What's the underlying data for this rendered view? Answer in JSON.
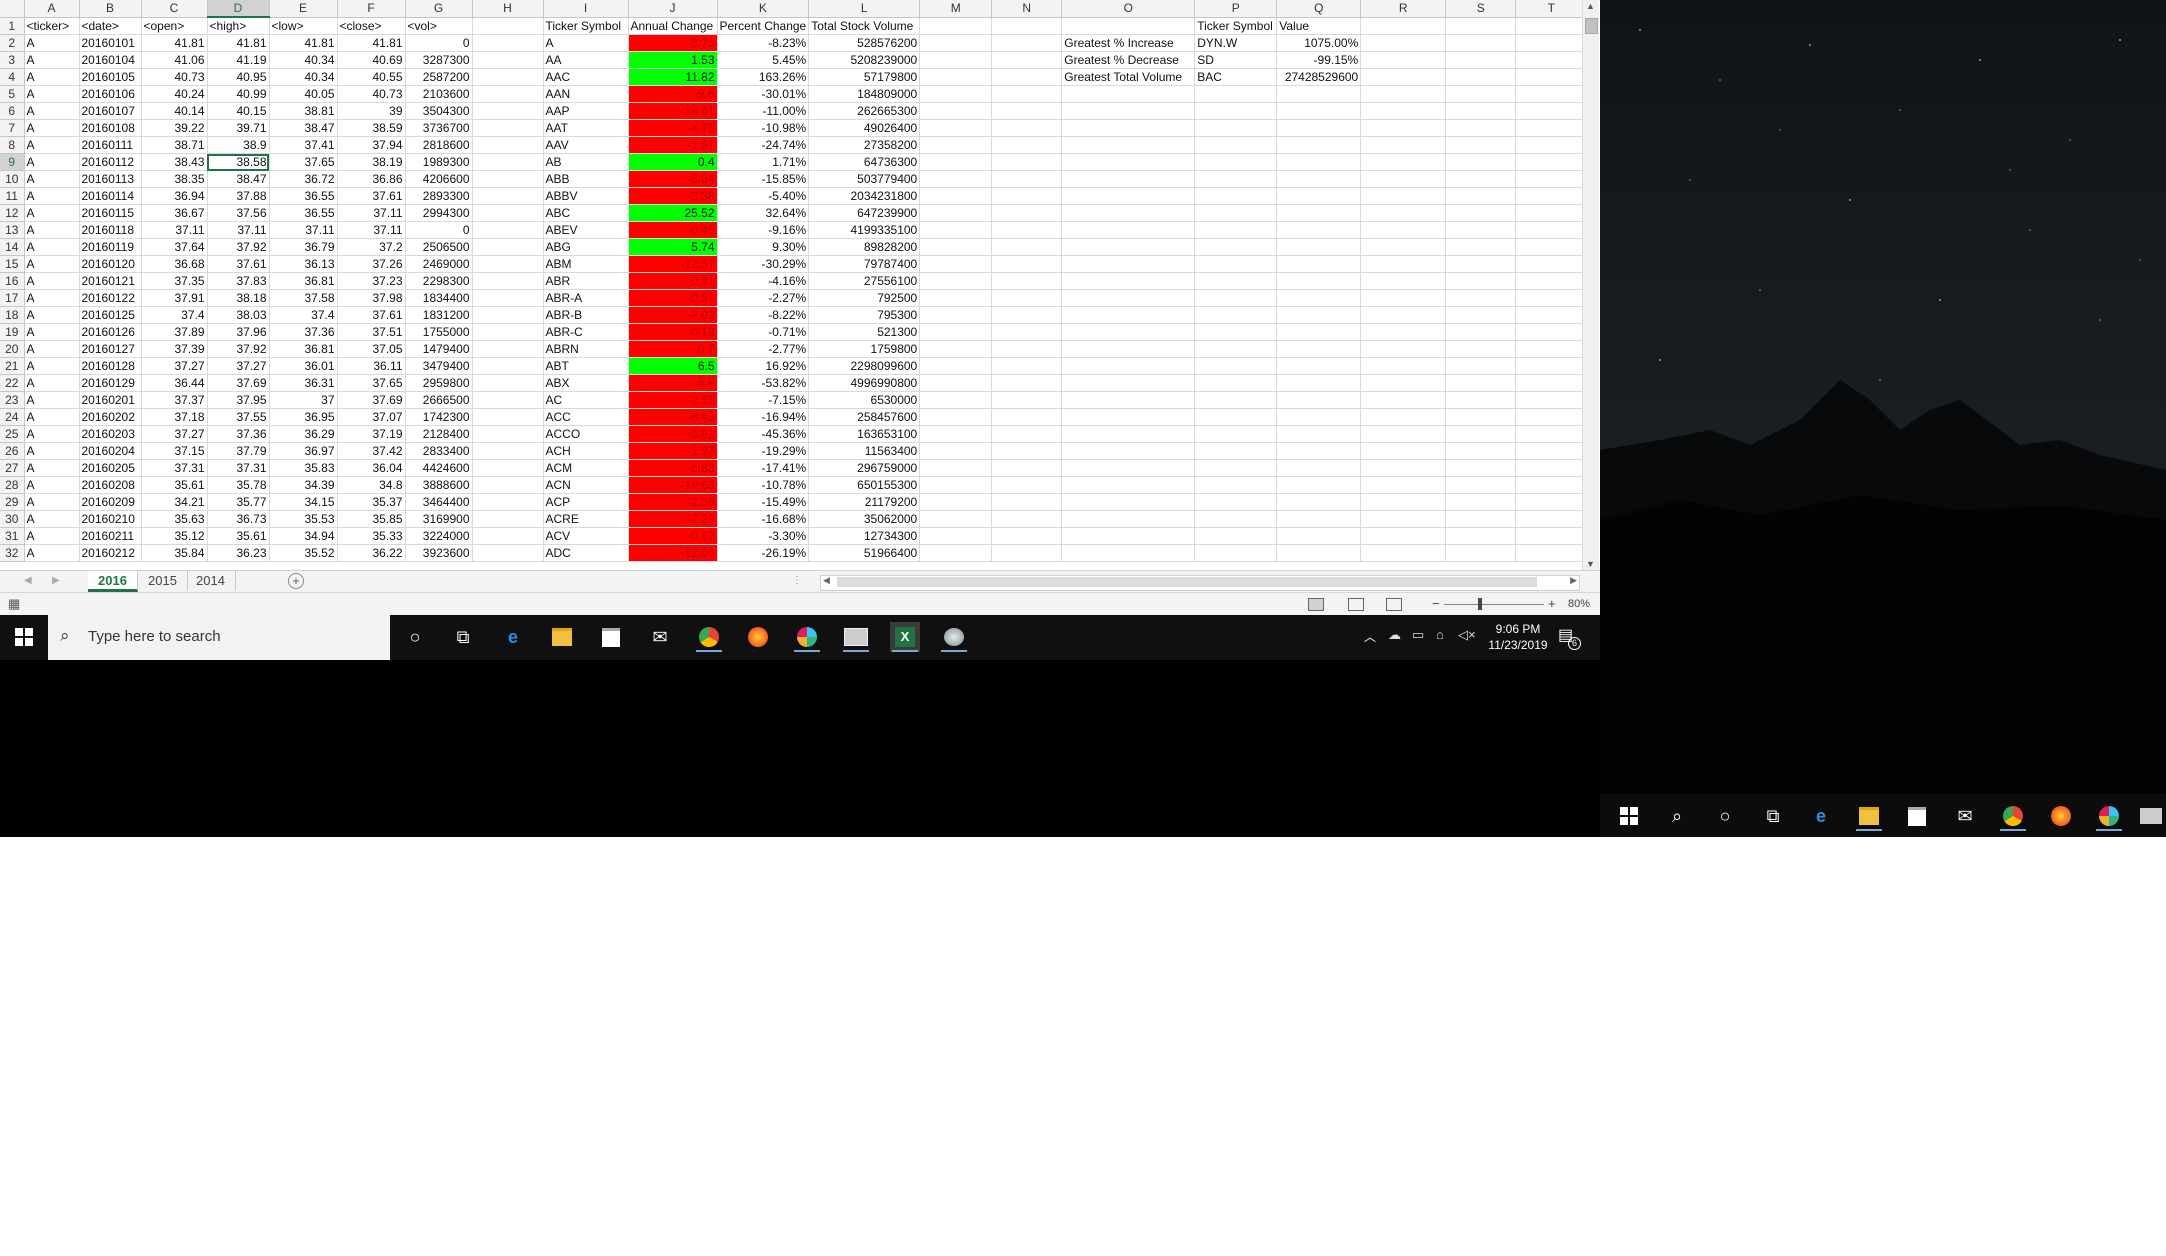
{
  "excel": {
    "columns": [
      "A",
      "B",
      "C",
      "D",
      "E",
      "F",
      "G",
      "H",
      "I",
      "J",
      "K",
      "L",
      "M",
      "N",
      "O",
      "P",
      "Q",
      "R",
      "S",
      "T"
    ],
    "selected_column": "D",
    "selected_row": 9,
    "rows": [
      {
        "n": "1",
        "A": "<ticker>",
        "B": "<date>",
        "C": "<open>",
        "D": "<high>",
        "E": "<low>",
        "F": "<close>",
        "G": "<vol>",
        "I": "Ticker Symbol",
        "J": "Annual Change",
        "K": "Percent Change",
        "L": "Total Stock Volume",
        "P": "Ticker Symbol",
        "Q": "Value"
      },
      {
        "n": "2",
        "A": "A",
        "B": "20160101",
        "C": "41.81",
        "D": "41.81",
        "E": "41.81",
        "F": "41.81",
        "G": "0",
        "I": "A",
        "J": "-3.75",
        "jc": "red",
        "K": "-8.23%",
        "L": "528576200",
        "O": "Greatest % Increase",
        "P": "DYN.W",
        "Q": "1075.00%"
      },
      {
        "n": "3",
        "A": "A",
        "B": "20160104",
        "C": "41.06",
        "D": "41.19",
        "E": "40.34",
        "F": "40.69",
        "G": "3287300",
        "I": "AA",
        "J": "1.53",
        "jc": "green",
        "K": "5.45%",
        "L": "5208239000",
        "O": "Greatest % Decrease",
        "P": "SD",
        "Q": "-99.15%"
      },
      {
        "n": "4",
        "A": "A",
        "B": "20160105",
        "C": "40.73",
        "D": "40.95",
        "E": "40.34",
        "F": "40.55",
        "G": "2587200",
        "I": "AAC",
        "J": "11.82",
        "jc": "green",
        "K": "163.26%",
        "L": "57179800",
        "O": "Greatest Total Volume",
        "P": "BAC",
        "Q": "27428529600"
      },
      {
        "n": "5",
        "A": "A",
        "B": "20160106",
        "C": "40.24",
        "D": "40.99",
        "E": "40.05",
        "F": "40.73",
        "G": "2103600",
        "I": "AAN",
        "J": "-9.6",
        "jc": "red",
        "K": "-30.01%",
        "L": "184809000"
      },
      {
        "n": "6",
        "A": "A",
        "B": "20160107",
        "C": "40.14",
        "D": "40.15",
        "E": "38.81",
        "F": "39",
        "G": "3504300",
        "I": "AAP",
        "J": "-18.61",
        "jc": "red",
        "K": "-11.00%",
        "L": "262665300"
      },
      {
        "n": "7",
        "A": "A",
        "B": "20160108",
        "C": "39.22",
        "D": "39.71",
        "E": "38.47",
        "F": "38.59",
        "G": "3736700",
        "I": "AAT",
        "J": "-4.75",
        "jc": "red",
        "K": "-10.98%",
        "L": "49026400"
      },
      {
        "n": "8",
        "A": "A",
        "B": "20160111",
        "C": "38.71",
        "D": "38.9",
        "E": "37.41",
        "F": "37.94",
        "G": "2818600",
        "I": "AAV",
        "J": "-1.67",
        "jc": "red",
        "K": "-24.74%",
        "L": "27358200"
      },
      {
        "n": "9",
        "A": "A",
        "B": "20160112",
        "C": "38.43",
        "D": "38.58",
        "E": "37.65",
        "F": "38.19",
        "G": "1989300",
        "I": "AB",
        "J": "0.4",
        "jc": "green",
        "K": "1.71%",
        "L": "64736300"
      },
      {
        "n": "10",
        "A": "A",
        "B": "20160113",
        "C": "38.35",
        "D": "38.47",
        "E": "36.72",
        "F": "36.86",
        "G": "4206600",
        "I": "ABB",
        "J": "-3.04",
        "jc": "red",
        "K": "-15.85%",
        "L": "503779400"
      },
      {
        "n": "11",
        "A": "A",
        "B": "20160114",
        "C": "36.94",
        "D": "37.88",
        "E": "36.55",
        "F": "37.61",
        "G": "2893300",
        "I": "ABBV",
        "J": "-3.38",
        "jc": "red",
        "K": "-5.40%",
        "L": "2034231800"
      },
      {
        "n": "12",
        "A": "A",
        "B": "20160115",
        "C": "36.67",
        "D": "37.56",
        "E": "36.55",
        "F": "37.11",
        "G": "2994300",
        "I": "ABC",
        "J": "25.52",
        "jc": "green",
        "K": "32.64%",
        "L": "647239900"
      },
      {
        "n": "13",
        "A": "A",
        "B": "20160118",
        "C": "37.11",
        "D": "37.11",
        "E": "37.11",
        "F": "37.11",
        "G": "0",
        "I": "ABEV",
        "J": "-0.45",
        "jc": "red",
        "K": "-9.16%",
        "L": "4199335100"
      },
      {
        "n": "14",
        "A": "A",
        "B": "20160119",
        "C": "37.64",
        "D": "37.92",
        "E": "36.79",
        "F": "37.2",
        "G": "2506500",
        "I": "ABG",
        "J": "5.74",
        "jc": "green",
        "K": "9.30%",
        "L": "89828200"
      },
      {
        "n": "15",
        "A": "A",
        "B": "20160120",
        "C": "36.68",
        "D": "37.61",
        "E": "36.13",
        "F": "37.26",
        "G": "2469000",
        "I": "ABM",
        "J": "-12.37",
        "jc": "red",
        "K": "-30.29%",
        "L": "79787400"
      },
      {
        "n": "16",
        "A": "A",
        "B": "20160121",
        "C": "37.35",
        "D": "37.83",
        "E": "36.81",
        "F": "37.23",
        "G": "2298300",
        "I": "ABR",
        "J": "-0.31",
        "jc": "red",
        "K": "-4.16%",
        "L": "27556100"
      },
      {
        "n": "17",
        "A": "A",
        "B": "20160122",
        "C": "37.91",
        "D": "38.18",
        "E": "37.58",
        "F": "37.98",
        "G": "1834400",
        "I": "ABR-A",
        "J": "-0.57",
        "jc": "red",
        "K": "-2.27%",
        "L": "792500"
      },
      {
        "n": "18",
        "A": "A",
        "B": "20160125",
        "C": "37.4",
        "D": "38.03",
        "E": "37.4",
        "F": "37.61",
        "G": "1831200",
        "I": "ABR-B",
        "J": "-2.02",
        "jc": "red",
        "K": "-8.22%",
        "L": "795300"
      },
      {
        "n": "19",
        "A": "A",
        "B": "20160126",
        "C": "37.89",
        "D": "37.96",
        "E": "37.36",
        "F": "37.51",
        "G": "1755000",
        "I": "ABR-C",
        "J": "-0.18",
        "jc": "red",
        "K": "-0.71%",
        "L": "521300"
      },
      {
        "n": "20",
        "A": "A",
        "B": "20160127",
        "C": "37.39",
        "D": "37.92",
        "E": "36.81",
        "F": "37.05",
        "G": "1479400",
        "I": "ABRN",
        "J": "-0.7",
        "jc": "red",
        "K": "-2.77%",
        "L": "1759800"
      },
      {
        "n": "21",
        "A": "A",
        "B": "20160128",
        "C": "37.27",
        "D": "37.27",
        "E": "36.01",
        "F": "36.11",
        "G": "3479400",
        "I": "ABT",
        "J": "6.5",
        "jc": "green",
        "K": "16.92%",
        "L": "2298099600"
      },
      {
        "n": "22",
        "A": "A",
        "B": "20160129",
        "C": "36.44",
        "D": "37.69",
        "E": "36.31",
        "F": "37.65",
        "G": "2959800",
        "I": "ABX",
        "J": "-8.6",
        "jc": "red",
        "K": "-53.82%",
        "L": "4996990800"
      },
      {
        "n": "23",
        "A": "A",
        "B": "20160201",
        "C": "37.37",
        "D": "37.95",
        "E": "37",
        "F": "37.69",
        "G": "2666500",
        "I": "AC",
        "J": "-2.35",
        "jc": "red",
        "K": "-7.15%",
        "L": "6530000"
      },
      {
        "n": "24",
        "A": "A",
        "B": "20160202",
        "C": "37.18",
        "D": "37.55",
        "E": "36.95",
        "F": "37.07",
        "G": "1742300",
        "I": "ACC",
        "J": "-8.43",
        "jc": "red",
        "K": "-16.94%",
        "L": "258457600"
      },
      {
        "n": "25",
        "A": "A",
        "B": "20160203",
        "C": "37.27",
        "D": "37.36",
        "E": "36.29",
        "F": "37.19",
        "G": "2128400",
        "I": "ACCO",
        "J": "-5.92",
        "jc": "red",
        "K": "-45.36%",
        "L": "163653100"
      },
      {
        "n": "26",
        "A": "A",
        "B": "20160204",
        "C": "37.15",
        "D": "37.79",
        "E": "36.97",
        "F": "37.42",
        "G": "2833400",
        "I": "ACH",
        "J": "-1.97",
        "jc": "red",
        "K": "-19.29%",
        "L": "11563400"
      },
      {
        "n": "27",
        "A": "A",
        "B": "20160205",
        "C": "37.31",
        "D": "37.31",
        "E": "35.83",
        "F": "36.04",
        "G": "4424600",
        "I": "ACM",
        "J": "-6.83",
        "jc": "red",
        "K": "-17.41%",
        "L": "296759000"
      },
      {
        "n": "28",
        "A": "A",
        "B": "20160208",
        "C": "35.61",
        "D": "35.78",
        "E": "34.39",
        "F": "34.8",
        "G": "3888600",
        "I": "ACN",
        "J": "-12.63",
        "jc": "red",
        "K": "-10.78%",
        "L": "650155300"
      },
      {
        "n": "29",
        "A": "A",
        "B": "20160209",
        "C": "34.21",
        "D": "35.77",
        "E": "34.15",
        "F": "35.37",
        "G": "3464400",
        "I": "ACP",
        "J": "-2.08",
        "jc": "red",
        "K": "-15.49%",
        "L": "21179200"
      },
      {
        "n": "30",
        "A": "A",
        "B": "20160210",
        "C": "35.63",
        "D": "36.73",
        "E": "35.53",
        "F": "35.85",
        "G": "3169900",
        "I": "ACRE",
        "J": "-2.29",
        "jc": "red",
        "K": "-16.68%",
        "L": "35062000"
      },
      {
        "n": "31",
        "A": "A",
        "B": "20160211",
        "C": "35.12",
        "D": "35.61",
        "E": "34.94",
        "F": "35.33",
        "G": "3224000",
        "I": "ACV",
        "J": "-0.62",
        "jc": "red",
        "K": "-3.30%",
        "L": "12734300"
      },
      {
        "n": "32",
        "A": "A",
        "B": "20160212",
        "C": "35.84",
        "D": "36.23",
        "E": "35.52",
        "F": "36.22",
        "G": "3923600",
        "I": "ADC",
        "J": "-12.06",
        "jc": "red",
        "K": "-26.19%",
        "L": "51966400"
      }
    ],
    "sheet_tabs": [
      {
        "label": "2016",
        "active": true
      },
      {
        "label": "2015",
        "active": false
      },
      {
        "label": "2014",
        "active": false
      }
    ],
    "zoom": "80%"
  },
  "taskbar": {
    "search_placeholder": "Type here to search",
    "time": "9:06 PM",
    "date": "11/23/2019",
    "notification_count": "6"
  },
  "colors": {
    "excel_green": "#217346",
    "negative_fill": "#ff0000",
    "positive_fill": "#00ff00"
  }
}
